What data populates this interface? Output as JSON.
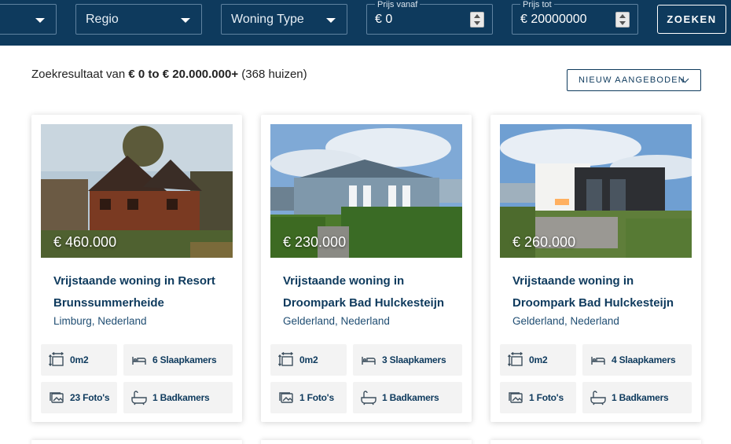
{
  "filters": {
    "first_select": "",
    "region_label": "Regio",
    "type_label": "Woning Type",
    "price_from_label": "Prijs vanaf",
    "price_from_value": "€ 0",
    "price_to_label": "Prijs tot",
    "price_to_value": "€ 20000000",
    "search_button": "ZOEKEN"
  },
  "results": {
    "prefix": "Zoekresultaat van ",
    "range": "€ 0 to € 20.000.000+",
    "count": " (368 huizen)",
    "sort_label": "NIEUW AANGEBODEN"
  },
  "listings": [
    {
      "price": "€ 460.000",
      "title": "Vrijstaande woning in Resort Brunssummerheide",
      "location": "Limburg, Nederland",
      "area": "0m2",
      "bedrooms": "6 Slaapkamers",
      "photos": "23 Foto's",
      "bathrooms": "1 Badkamers"
    },
    {
      "price": "€ 230.000",
      "title": "Vrijstaande woning in Droompark Bad Hulckesteijn",
      "location": "Gelderland, Nederland",
      "area": "0m2",
      "bedrooms": "3 Slaapkamers",
      "photos": "1 Foto's",
      "bathrooms": "1 Badkamers"
    },
    {
      "price": "€ 260.000",
      "title": "Vrijstaande woning in Droompark Bad Hulckesteijn",
      "location": "Gelderland, Nederland",
      "area": "0m2",
      "bedrooms": "4 Slaapkamers",
      "photos": "1 Foto's",
      "bathrooms": "1 Badkamers"
    }
  ],
  "colors": {
    "brand_navy": "#0e3a5d",
    "tile_bg": "#f3f3f3"
  }
}
